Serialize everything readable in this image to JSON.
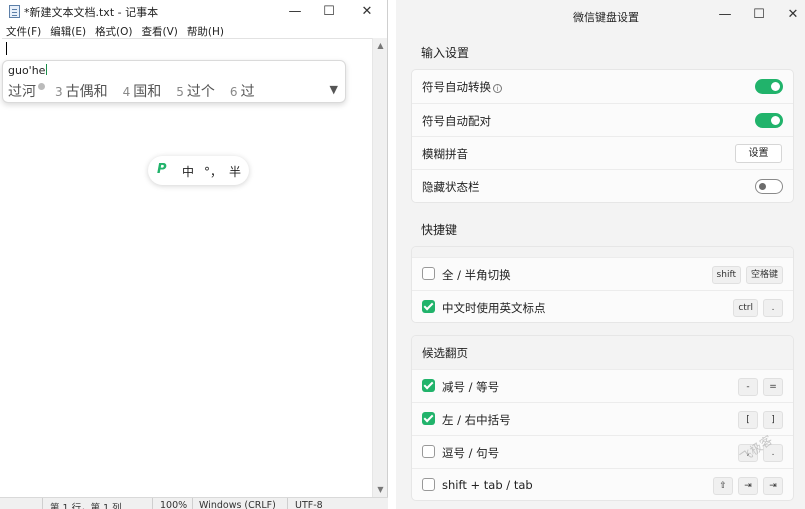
{
  "notepad": {
    "title": "*新建文本文档.txt - 记事本",
    "window_controls": {
      "minimize": "—",
      "maximize": "☐",
      "close": "✕"
    },
    "menu": [
      "文件(F)",
      "编辑(E)",
      "格式(O)",
      "查看(V)",
      "帮助(H)"
    ],
    "status": {
      "position": "第 1 行，第 1 列",
      "zoom": "100%",
      "line_ending": "Windows (CRLF)",
      "encoding": "UTF-8"
    }
  },
  "ime": {
    "pinyin": "guo'he",
    "candidates": [
      {
        "num": "",
        "text": "过河"
      },
      {
        "num": "3",
        "text": "古偶和"
      },
      {
        "num": "4",
        "text": "国和"
      },
      {
        "num": "5",
        "text": "过个"
      },
      {
        "num": "6",
        "text": "过"
      }
    ],
    "status_bar": {
      "mode": "中",
      "punct": "°，",
      "width": "半"
    }
  },
  "settings": {
    "title": "微信键盘设置",
    "window_controls": {
      "minimize": "—",
      "maximize": "☐",
      "close": "✕"
    },
    "input_section": {
      "title": "输入设置",
      "items": [
        {
          "label": "符号自动转换",
          "control": "toggle",
          "on": true
        },
        {
          "label": "符号自动配对",
          "control": "toggle",
          "on": true
        },
        {
          "label": "模糊拼音",
          "control": "button",
          "button_label": "设置"
        },
        {
          "label": "隐藏状态栏",
          "control": "toggle",
          "on": false
        }
      ]
    },
    "shortcut_section": {
      "title": "快捷键",
      "items": [
        {
          "label": "全 / 半角切换",
          "checked": false,
          "keys": [
            "shift",
            "空格键"
          ]
        },
        {
          "label": "中文时使用英文标点",
          "checked": true,
          "keys": [
            "ctrl",
            "."
          ]
        }
      ]
    },
    "paging_section": {
      "title": "候选翻页",
      "items": [
        {
          "label": "减号 / 等号",
          "checked": true,
          "keys": [
            "-",
            "="
          ]
        },
        {
          "label": "左 / 右中括号",
          "checked": true,
          "keys": [
            "[",
            "]"
          ]
        },
        {
          "label": "逗号 / 句号",
          "checked": false,
          "keys": [
            ",",
            "."
          ]
        },
        {
          "label": "shift + tab / tab",
          "checked": false,
          "keys": [
            "⇧",
            "⇥",
            "⇥"
          ]
        }
      ]
    },
    "accent_color": "#21b36b"
  },
  "watermark": "飞极客"
}
